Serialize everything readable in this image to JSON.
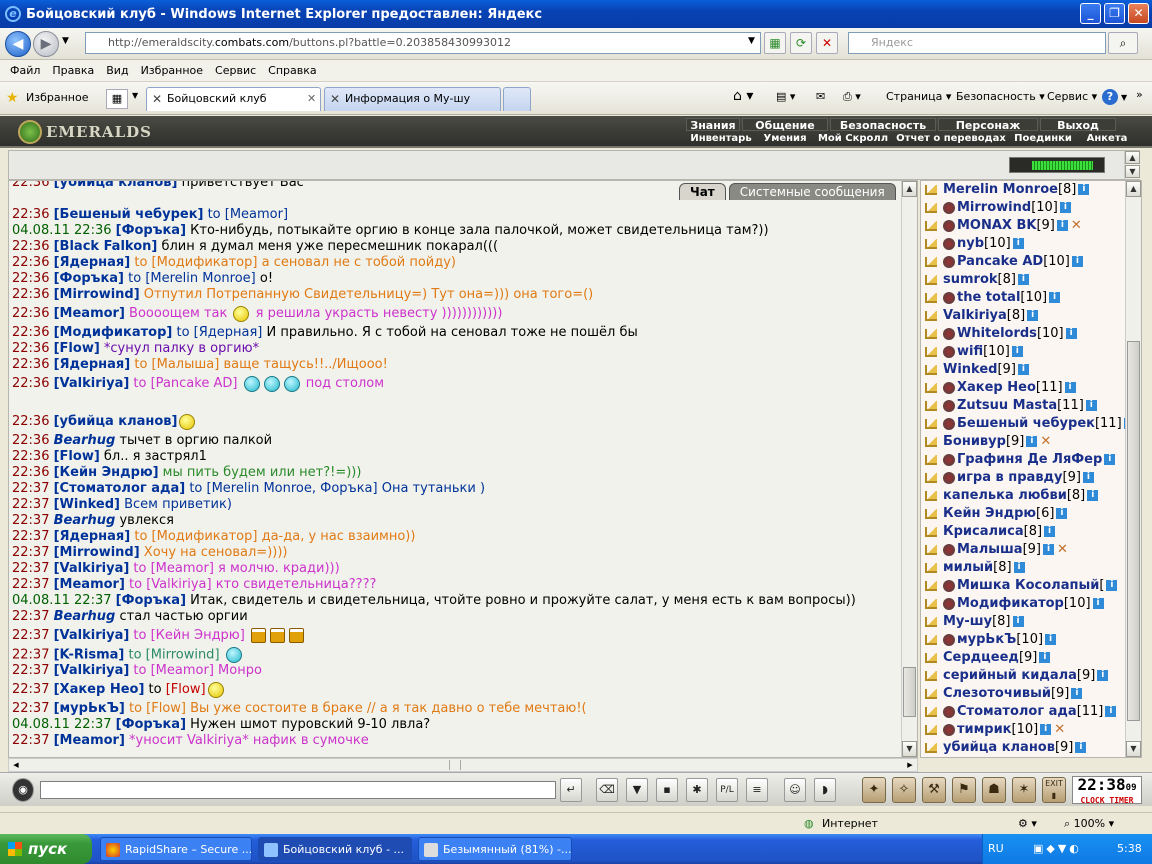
{
  "window": {
    "title": "Бойцовский клуб - Windows Internet Explorer предоставлен: Яндекс"
  },
  "address": {
    "url_pre": "http://emeraldscity.",
    "url_domain": "combats.com",
    "url_post": "/buttons.pl?battle=0.203858430993012",
    "search_placeholder": "Яндекс"
  },
  "menu": [
    "Файл",
    "Правка",
    "Вид",
    "Избранное",
    "Сервис",
    "Справка"
  ],
  "favorites_label": "Избранное",
  "tabs": [
    {
      "label": "Бойцовский клуб"
    },
    {
      "label": "Информация о Му-шу"
    }
  ],
  "commands": {
    "page": "Страница",
    "security": "Безопасность",
    "service": "Сервис"
  },
  "game": {
    "logo": "EMERALDS",
    "menu_top": [
      "Знания",
      "Общение",
      "Безопасность",
      "Персонаж",
      "Выход"
    ],
    "menu_bottom": [
      "Инвентарь",
      "Умения",
      "Мой Скролл",
      "Отчет о переводах",
      "Поединки",
      "Анкета"
    ],
    "hp_fill": 0.85,
    "chat_tabs": [
      "Чат",
      "Системные сообщения"
    ]
  },
  "chat": [
    {
      "t": "22:36",
      "parts": [
        {
          "c": "n",
          "x": "[убийца кланов]"
        },
        {
          "c": "t2",
          "x": " приветствует Вас"
        }
      ]
    },
    {
      "t": "",
      "parts": [
        {
          "c": "",
          "x": ""
        }
      ],
      "gap": true
    },
    {
      "t": "22:36",
      "parts": [
        {
          "c": "n",
          "x": "[Бешеный чебурек]"
        },
        {
          "c": "to",
          "x": " to [Meamor]"
        }
      ]
    },
    {
      "t": "04.08.11 22:36",
      "parts": [
        {
          "c": "n",
          "x": "[Форъка]"
        },
        {
          "c": "t2",
          "x": " Кто-нибудь, потыкайте оргию в конце зала палочкой, может свидетельница там?))"
        }
      ]
    },
    {
      "t": "22:36",
      "parts": [
        {
          "c": "n",
          "x": "[Black Falkon]"
        },
        {
          "c": "t2",
          "x": " блин я думал меня уже пересмешник покарал((("
        }
      ]
    },
    {
      "t": "22:36",
      "parts": [
        {
          "c": "n",
          "x": "[Ядерная]"
        },
        {
          "c": "or",
          "x": " to [Модификатор] а сеновал не с тобой пойду)"
        }
      ]
    },
    {
      "t": "22:36",
      "parts": [
        {
          "c": "n",
          "x": "[Форъка]"
        },
        {
          "c": "to",
          "x": " to [Merelin Monroe]"
        },
        {
          "c": "t2",
          "x": " о!"
        }
      ]
    },
    {
      "t": "22:36",
      "parts": [
        {
          "c": "n",
          "x": "[Mirrowind]"
        },
        {
          "c": "or",
          "x": " Отпутил Потрепанную Свидетельницу=) Тут она=))) она того=()"
        }
      ]
    },
    {
      "t": "22:36",
      "parts": [
        {
          "c": "n",
          "x": "[Meamor]"
        },
        {
          "c": "mg",
          "x": " Воооощем так    "
        },
        {
          "c": "sm",
          "x": ""
        },
        {
          "c": "mg",
          "x": "    я решила украсть невесту ))))))))))))"
        }
      ],
      "big": true
    },
    {
      "t": "22:36",
      "parts": [
        {
          "c": "n",
          "x": "[Модификатор]"
        },
        {
          "c": "to",
          "x": " to [Ядерная]"
        },
        {
          "c": "t2",
          "x": " И правильно. Я с тобой на сеновал тоже не пошёл бы"
        }
      ]
    },
    {
      "t": "22:36",
      "parts": [
        {
          "c": "n",
          "x": "[Flow]"
        },
        {
          "c": "pu",
          "x": " *сунул палку в оргию*"
        }
      ]
    },
    {
      "t": "22:36",
      "parts": [
        {
          "c": "n",
          "x": "[Ядерная]"
        },
        {
          "c": "or",
          "x": " to [Малыша] ваще тащусь!!../Ищооо!"
        }
      ]
    },
    {
      "t": "22:36",
      "parts": [
        {
          "c": "n",
          "x": "[Valkiriya]"
        },
        {
          "c": "mg",
          "x": " to [Pancake AD] "
        },
        {
          "c": "smg",
          "x": ""
        },
        {
          "c": "smg",
          "x": ""
        },
        {
          "c": "smg",
          "x": ""
        },
        {
          "c": "mg",
          "x": " под столом"
        }
      ],
      "big": true
    },
    {
      "t": "",
      "parts": [
        {
          "c": "",
          "x": ""
        }
      ],
      "gap": true
    },
    {
      "t": "22:36",
      "parts": [
        {
          "c": "n",
          "x": "[убийца кланов]"
        },
        {
          "c": "sm",
          "x": ""
        }
      ],
      "big": true
    },
    {
      "t": "22:36",
      "parts": [
        {
          "c": "n i",
          "x": "Bearhug"
        },
        {
          "c": "t2 i",
          "x": " тычет в оргию палкой"
        }
      ]
    },
    {
      "t": "22:36",
      "parts": [
        {
          "c": "n",
          "x": "[Flow]"
        },
        {
          "c": "t2",
          "x": " бл.. я застрял1"
        }
      ]
    },
    {
      "t": "22:36",
      "parts": [
        {
          "c": "n",
          "x": "[Кейн Эндрю]"
        },
        {
          "c": "gr",
          "x": " мы пить будем или нет?!=)))"
        }
      ]
    },
    {
      "t": "22:37",
      "parts": [
        {
          "c": "n",
          "x": "[Стоматолог ада]"
        },
        {
          "c": "to",
          "x": " to [Merelin Monroe, Форъка] Она тутаньки )"
        }
      ]
    },
    {
      "t": "22:37",
      "parts": [
        {
          "c": "n",
          "x": "[Winked]"
        },
        {
          "c": "to",
          "x": " Всем приветик)"
        }
      ]
    },
    {
      "t": "22:37",
      "parts": [
        {
          "c": "n i",
          "x": "Bearhug"
        },
        {
          "c": "t2 i",
          "x": " увлекся"
        }
      ]
    },
    {
      "t": "22:37",
      "parts": [
        {
          "c": "n",
          "x": "[Ядерная]"
        },
        {
          "c": "or",
          "x": " to [Модификатор] да-да, у нас взаимно))"
        }
      ]
    },
    {
      "t": "22:37",
      "parts": [
        {
          "c": "n",
          "x": "[Mirrowind]"
        },
        {
          "c": "or",
          "x": " Хочу на сеновал=))))"
        }
      ]
    },
    {
      "t": "22:37",
      "parts": [
        {
          "c": "n",
          "x": "[Valkiriya]"
        },
        {
          "c": "mg",
          "x": " to [Meamor] я молчю. кради)))"
        }
      ]
    },
    {
      "t": "22:37",
      "parts": [
        {
          "c": "n",
          "x": "[Meamor]"
        },
        {
          "c": "mg",
          "x": " to [Valkiriya] кто свидетельница????"
        }
      ]
    },
    {
      "t": "04.08.11 22:37",
      "parts": [
        {
          "c": "n",
          "x": "[Форъка]"
        },
        {
          "c": "t2",
          "x": " Итак, свидетель и свидетельница, чтойте ровно и прожуйте салат, у меня есть к вам вопросы))"
        }
      ]
    },
    {
      "t": "22:37",
      "parts": [
        {
          "c": "n i",
          "x": "Bearhug"
        },
        {
          "c": "t2 i",
          "x": " стал частью оргии"
        }
      ]
    },
    {
      "t": "22:37",
      "parts": [
        {
          "c": "n",
          "x": "[Valkiriya]"
        },
        {
          "c": "mg",
          "x": " to [Кейн Эндрю] "
        },
        {
          "c": "beer",
          "x": ""
        },
        {
          "c": "beer",
          "x": ""
        },
        {
          "c": "beer",
          "x": ""
        }
      ],
      "big": true
    },
    {
      "t": "22:37",
      "parts": [
        {
          "c": "n",
          "x": "[K-Risma]"
        },
        {
          "c": "tl",
          "x": " to [Mirrowind] "
        },
        {
          "c": "smg",
          "x": ""
        }
      ]
    },
    {
      "t": "22:37",
      "parts": [
        {
          "c": "n",
          "x": "[Valkiriya]"
        },
        {
          "c": "mg",
          "x": " to [Meamor] Монро"
        }
      ]
    },
    {
      "t": "22:37",
      "parts": [
        {
          "c": "n",
          "x": "[Хакер Нео]"
        },
        {
          "c": "t2",
          "x": " to "
        },
        {
          "c": "rd",
          "x": "[Flow]"
        },
        {
          "c": "sm",
          "x": ""
        }
      ],
      "big": true
    },
    {
      "t": "22:37",
      "parts": [
        {
          "c": "n",
          "x": "[мурЬкЪ]"
        },
        {
          "c": "or",
          "x": " to [Flow] Вы уже состоите в браке // а я так давно о тебе мечтаю!("
        }
      ]
    },
    {
      "t": "04.08.11 22:37",
      "parts": [
        {
          "c": "n",
          "x": "[Форъка]"
        },
        {
          "c": "t2",
          "x": " Нужен шмот пуровский 9-10 лвла?"
        }
      ]
    },
    {
      "t": "22:37",
      "parts": [
        {
          "c": "n",
          "x": "[Meamor]"
        },
        {
          "c": "mg",
          "x": " *уносит Valkiriya* нафик в сумочке"
        }
      ]
    }
  ],
  "users": [
    {
      "name": "Merelin Monroe",
      "lvl": "[8]"
    },
    {
      "name": "Mirrowind",
      "lvl": "[10]",
      "clan": true
    },
    {
      "name": "MONAX BK",
      "lvl": "[9]",
      "clan": true,
      "swords": true
    },
    {
      "name": "nyb",
      "lvl": "[10]",
      "clan": true
    },
    {
      "name": "Pancake AD",
      "lvl": "[10]",
      "clan": true
    },
    {
      "name": "sumrok",
      "lvl": "[8]"
    },
    {
      "name": "the total",
      "lvl": "[10]",
      "clan": true
    },
    {
      "name": "Valkiriya",
      "lvl": "[8]"
    },
    {
      "name": "Whitelords",
      "lvl": "[10]",
      "clan": true
    },
    {
      "name": "wifi",
      "lvl": "[10]",
      "clan": true
    },
    {
      "name": "Winked",
      "lvl": "[9]"
    },
    {
      "name": "Хакер Нео",
      "lvl": "[11]",
      "clan": true
    },
    {
      "name": "Zutsuu Masta",
      "lvl": "[11]",
      "clan": true
    },
    {
      "name": "Бешеный чебурек",
      "lvl": "[11]",
      "clan": true
    },
    {
      "name": "Бонивур",
      "lvl": "[9]",
      "swords": true
    },
    {
      "name": "Графиня Де ЛяФер",
      "lvl": "",
      "clan": true
    },
    {
      "name": "игра в правду",
      "lvl": "[9]",
      "clan": true
    },
    {
      "name": "капелька любви",
      "lvl": "[8]"
    },
    {
      "name": "Кейн Эндрю",
      "lvl": "[6]"
    },
    {
      "name": "Крисалиса",
      "lvl": "[8]"
    },
    {
      "name": "Малыша",
      "lvl": "[9]",
      "clan": true,
      "swords": true
    },
    {
      "name": "милый",
      "lvl": "[8]"
    },
    {
      "name": "Мишка Косолапый",
      "lvl": "[",
      "clan": true
    },
    {
      "name": "Модификатор",
      "lvl": "[10]",
      "clan": true
    },
    {
      "name": "Му-шу",
      "lvl": "[8]"
    },
    {
      "name": "мурЬкЪ",
      "lvl": "[10]",
      "clan": true
    },
    {
      "name": "Сердцеед",
      "lvl": "[9]"
    },
    {
      "name": "серийный кидала",
      "lvl": "[9]"
    },
    {
      "name": "Слезоточивый",
      "lvl": "[9]"
    },
    {
      "name": "Стоматолог ада",
      "lvl": "[11]",
      "clan": true
    },
    {
      "name": "тимрик",
      "lvl": "[10]",
      "clan": true,
      "swords": true
    },
    {
      "name": "убийца кланов",
      "lvl": "[9]"
    }
  ],
  "clock": {
    "time": "22:38",
    "sec": "09",
    "clock_label": "CLOCK",
    "timer_label": "TIMER"
  },
  "ie_status": {
    "zone": "Интернет",
    "zoom": "100%"
  },
  "taskbar": {
    "start": "пуск",
    "tasks": [
      "RapidShare – Secure ...",
      "Бойцовский клуб - ...",
      "Безымянный (81%) -..."
    ],
    "lang": "RU",
    "time": "5:38"
  },
  "colors": {
    "title_blue": "#0842b4",
    "nick_blue": "#003399",
    "time_red": "#8b0000",
    "orange": "#e07a14",
    "magenta": "#cc33cc"
  }
}
